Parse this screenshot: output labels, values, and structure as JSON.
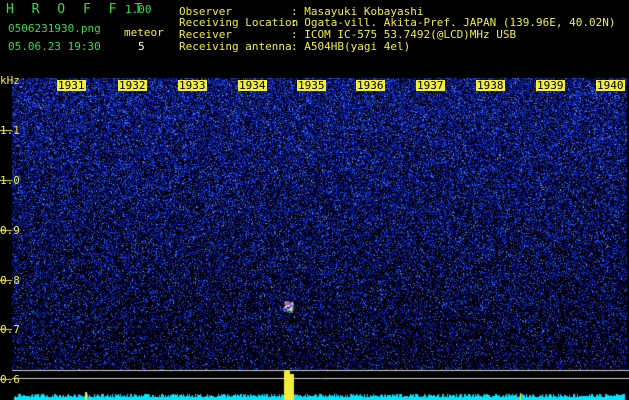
{
  "app": {
    "name": "H R O F F T",
    "version": "1.00"
  },
  "file": {
    "name": "0506231930.png",
    "datetime": "05.06.23 19:30"
  },
  "meteor": {
    "label": "meteor",
    "count": "5"
  },
  "station": {
    "observer_label": "Observer",
    "observer": ": Masayuki Kobayashi",
    "location_label": "Receiving Location",
    "location": ": Ogata-vill. Akita-Pref. JAPAN (139.96E, 40.02N)",
    "receiver_label": "Receiver",
    "receiver": ": ICOM IC-575 53.7492(@LCD)MHz USB",
    "antenna_label": "Receiving antenna",
    "antenna": ": A504HB(yagi 4el)"
  },
  "spectrogram": {
    "unit": "kHz",
    "time_ticks": [
      "1931",
      "1932",
      "1933",
      "1934",
      "1935",
      "1936",
      "1937",
      "1938",
      "1939",
      "1940"
    ],
    "freq_ticks": [
      "1.1",
      "1.0",
      "0.9",
      "0.8",
      "0.7",
      "0.6"
    ],
    "colors": {
      "background": "#000000",
      "noise_dark": "#0a1f9a",
      "noise_light": "#2f5fff",
      "level_bar": "#00e5ff",
      "marker": "#f2ee3a"
    }
  }
}
